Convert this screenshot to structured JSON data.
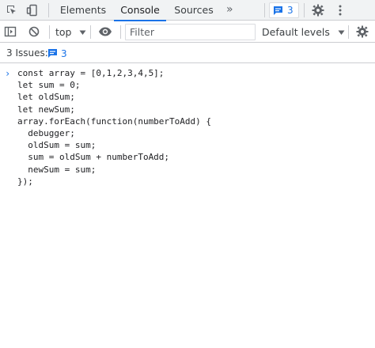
{
  "tabbar": {
    "tabs": [
      {
        "label": "Elements"
      },
      {
        "label": "Console"
      },
      {
        "label": "Sources"
      }
    ],
    "more_label": "»",
    "issues_count": "3",
    "icons": [
      "inspect-icon",
      "device-toolbar-icon",
      "chevron-more-icon",
      "message-icon",
      "gear-icon",
      "kebab-menu-icon"
    ]
  },
  "toolbar": {
    "context": "top",
    "filter_placeholder": "Filter",
    "levels": "Default levels",
    "icons": [
      "sidebar-toggle-icon",
      "clear-console-icon",
      "dropdown-arrow-icon",
      "live-expression-eye-icon",
      "dropdown-arrow-icon",
      "gear-icon"
    ]
  },
  "issues": {
    "label": "3 Issues:",
    "count": "3"
  },
  "console": {
    "prompt": "›",
    "code": "const array = [0,1,2,3,4,5];\nlet sum = 0;\nlet oldSum;\nlet newSum;\narray.forEach(function(numberToAdd) {\n  debugger;\n  oldSum = sum;\n  sum = oldSum + numberToAdd;\n  newSum = sum;\n});"
  },
  "colors": {
    "accent": "#1a73e8",
    "toolbar_bg": "#f1f3f4",
    "border": "#cbcdd1",
    "text": "#202124",
    "icon": "#5f6368"
  }
}
